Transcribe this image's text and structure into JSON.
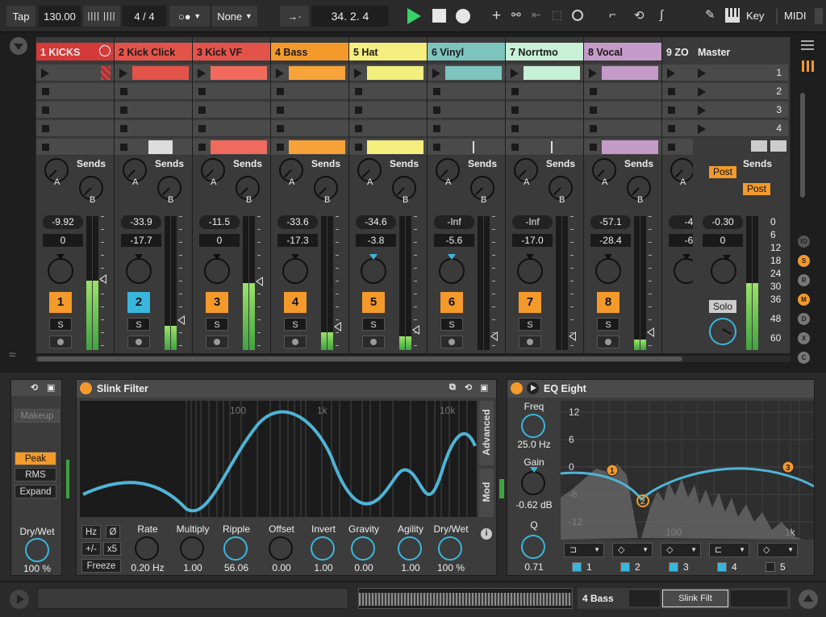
{
  "topbar": {
    "tap": "Tap",
    "tempo": "130.00",
    "signature": "4 / 4",
    "metro_dots": "○●",
    "quantize": "None",
    "position": "34.  2.  4",
    "key": "Key",
    "midi": "MIDI"
  },
  "tracks": [
    {
      "name": "1 KICKS",
      "color": "#d43a3a",
      "vol": "-9.92",
      "pan": "0",
      "num": "1",
      "num_color": "#f39a2b",
      "level": 0.52,
      "clip_color": "#b44"
    },
    {
      "name": "2 Kick Click",
      "color": "#e4534a",
      "vol": "-33.9",
      "pan": "-17.7",
      "num": "2",
      "num_color": "#3ab6dd",
      "level": 0.18,
      "clip_color": "#e4534a"
    },
    {
      "name": "3 Kick VF",
      "color": "#e4534a",
      "vol": "-11.5",
      "pan": "0",
      "num": "3",
      "num_color": "#f39a2b",
      "level": 0.5,
      "clip_color": "#f06a5e"
    },
    {
      "name": "4 Bass",
      "color": "#f39a2b",
      "vol": "-33.6",
      "pan": "-17.3",
      "num": "4",
      "num_color": "#f39a2b",
      "level": 0.13,
      "clip_color": "#f7a33a"
    },
    {
      "name": "5 Hat",
      "color": "#f4ee7e",
      "vol": "-34.6",
      "pan": "-3.8",
      "num": "5",
      "num_color": "#f39a2b",
      "level": 0.1,
      "clip_color": "#f4ee7e"
    },
    {
      "name": "6 Vinyl",
      "color": "#7ec4bf",
      "vol": "-Inf",
      "pan": "-5.6",
      "num": "6",
      "num_color": "#f39a2b",
      "level": 0,
      "clip_color": "#7ec4bf"
    },
    {
      "name": "7 Norrtmo",
      "color": "#c8f0d6",
      "vol": "-Inf",
      "pan": "-17.0",
      "num": "7",
      "num_color": "#f39a2b",
      "level": 0,
      "clip_color": "#c8f0d6"
    },
    {
      "name": "8 Vocal",
      "color": "#c49ac8",
      "vol": "-57.1",
      "pan": "-28.4",
      "num": "8",
      "num_color": "#f39a2b",
      "level": 0.08,
      "clip_color": "#c49ac8"
    },
    {
      "name": "9 ZO",
      "color": "#3a3a3a",
      "vol": "-4",
      "pan": "-6",
      "num": "",
      "num_color": "#f39a2b",
      "level": 0,
      "clip_color": "#555"
    }
  ],
  "sends_label": "Sends",
  "send_a": "A",
  "send_b": "B",
  "solo_label": "S",
  "master": {
    "name": "Master",
    "scenes": [
      "1",
      "2",
      "3",
      "4"
    ],
    "post1": "Post",
    "post2": "Post",
    "vol": "-0.30",
    "pan": "0",
    "solo": "Solo",
    "scale": [
      "0",
      "6",
      "12",
      "18",
      "24",
      "30",
      "36",
      "48",
      "60"
    ],
    "level": 0.5
  },
  "side_buttons": [
    "IO",
    "S",
    "R",
    "M",
    "D",
    "X",
    "C"
  ],
  "compressor": {
    "makeup": "Makeup",
    "peak": "Peak",
    "rms": "RMS",
    "expand": "Expand",
    "drywet_label": "Dry/Wet",
    "drywet_value": "100 %"
  },
  "slink": {
    "title": "Slink Filter",
    "axis": [
      "100",
      "1k",
      "10k"
    ],
    "tab_advanced": "Advanced",
    "tab_mod": "Mod",
    "btn_hz": "Hz",
    "btn_phase": "Ø",
    "btn_pm": "+/-",
    "btn_x5": "x5",
    "btn_freeze": "Freeze",
    "params": [
      {
        "label": "Rate",
        "value": "0.20 Hz"
      },
      {
        "label": "Multiply",
        "value": "1.00"
      },
      {
        "label": "Ripple",
        "value": "56.06"
      },
      {
        "label": "Offset",
        "value": "0.00"
      },
      {
        "label": "Invert",
        "value": "1.00"
      },
      {
        "label": "Gravity",
        "value": "0.00"
      },
      {
        "label": "Agility",
        "value": "1.00"
      },
      {
        "label": "Dry/Wet",
        "value": "100 %"
      }
    ]
  },
  "eq": {
    "title": "EQ Eight",
    "freq_label": "Freq",
    "freq_value": "25.0 Hz",
    "gain_label": "Gain",
    "gain_value": "-0.62 dB",
    "q_label": "Q",
    "q_value": "0.71",
    "yticks": [
      "12",
      "6",
      "0",
      "-6",
      "-12"
    ],
    "xticks": [
      "100",
      "1k"
    ],
    "bands": [
      "1",
      "2",
      "3",
      "4",
      "5"
    ],
    "points": [
      "1",
      "2",
      "3"
    ]
  },
  "bottom": {
    "track_name": "4 Bass",
    "device_name": "Slink Filt"
  }
}
